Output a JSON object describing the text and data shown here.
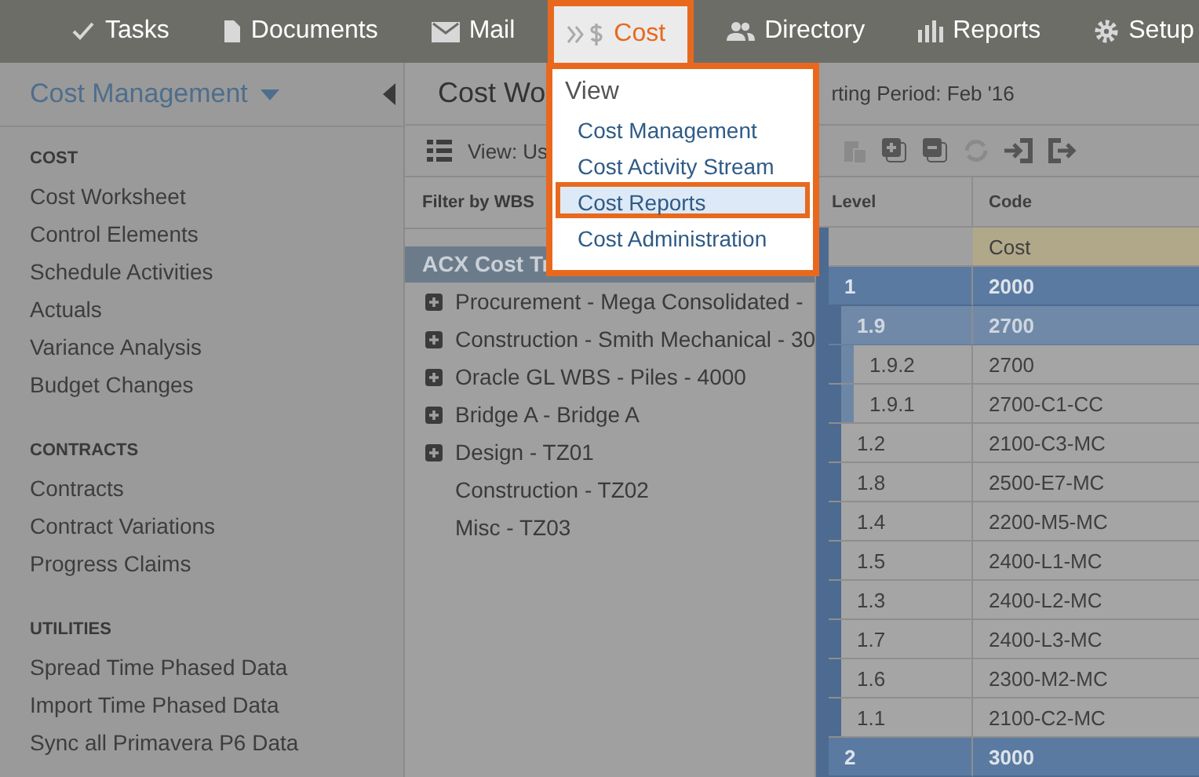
{
  "nav": [
    {
      "label": "Tasks",
      "selected": false
    },
    {
      "label": "Documents",
      "selected": false
    },
    {
      "label": "Mail",
      "selected": false
    },
    {
      "label": "Cost",
      "selected": true
    },
    {
      "label": "Directory",
      "selected": false
    },
    {
      "label": "Reports",
      "selected": false
    },
    {
      "label": "Setup",
      "selected": false
    }
  ],
  "menu": {
    "heading": "View",
    "items": [
      {
        "label": "Cost Management",
        "selected": false
      },
      {
        "label": "Cost Activity Stream",
        "selected": false
      },
      {
        "label": "Cost Reports",
        "selected": true
      },
      {
        "label": "Cost Administration",
        "selected": false
      }
    ]
  },
  "sidebar": {
    "title": "Cost Management",
    "sections": [
      {
        "heading": "COST",
        "items": [
          "Cost Worksheet",
          "Control Elements",
          "Schedule Activities",
          "Actuals",
          "Variance Analysis",
          "Budget Changes"
        ]
      },
      {
        "heading": "CONTRACTS",
        "items": [
          "Contracts",
          "Contract Variations",
          "Progress Claims"
        ]
      },
      {
        "heading": "UTILITIES",
        "items": [
          "Spread Time Phased Data",
          "Import Time Phased Data",
          "Sync all Primavera P6 Data"
        ]
      }
    ]
  },
  "header": {
    "title": "Cost Wo",
    "period": "rting Period: Feb '16"
  },
  "toolbar": {
    "view_label": "View: Us"
  },
  "filter": {
    "label": "Filter by WBS",
    "root": "ACX Cost Tr",
    "items": [
      {
        "label": "Procurement - Mega Consolidated -",
        "expandable": true
      },
      {
        "label": "Construction - Smith Mechanical - 30",
        "expandable": true
      },
      {
        "label": "Oracle GL WBS - Piles - 4000",
        "expandable": true
      },
      {
        "label": "Bridge A - Bridge A",
        "expandable": true
      },
      {
        "label": "Design - TZ01",
        "expandable": true
      },
      {
        "label": "Construction - TZ02",
        "expandable": false
      },
      {
        "label": "Misc - TZ03",
        "expandable": false
      }
    ]
  },
  "table": {
    "columns": [
      "Level",
      "Code"
    ],
    "group_label": "Cost",
    "rows": [
      {
        "level": "1",
        "code": "2000",
        "children": [
          {
            "level": "1.9",
            "code": "2700",
            "children": [
              {
                "level": "1.9.2",
                "code": "2700"
              },
              {
                "level": "1.9.1",
                "code": "2700-C1-CC"
              }
            ]
          },
          {
            "level": "1.2",
            "code": "2100-C3-MC"
          },
          {
            "level": "1.8",
            "code": "2500-E7-MC"
          },
          {
            "level": "1.4",
            "code": "2200-M5-MC"
          },
          {
            "level": "1.5",
            "code": "2400-L1-MC"
          },
          {
            "level": "1.3",
            "code": "2400-L2-MC"
          },
          {
            "level": "1.7",
            "code": "2400-L3-MC"
          },
          {
            "level": "1.6",
            "code": "2300-M2-MC"
          },
          {
            "level": "1.1",
            "code": "2100-C2-MC"
          }
        ]
      },
      {
        "level": "2",
        "code": "3000"
      }
    ]
  }
}
